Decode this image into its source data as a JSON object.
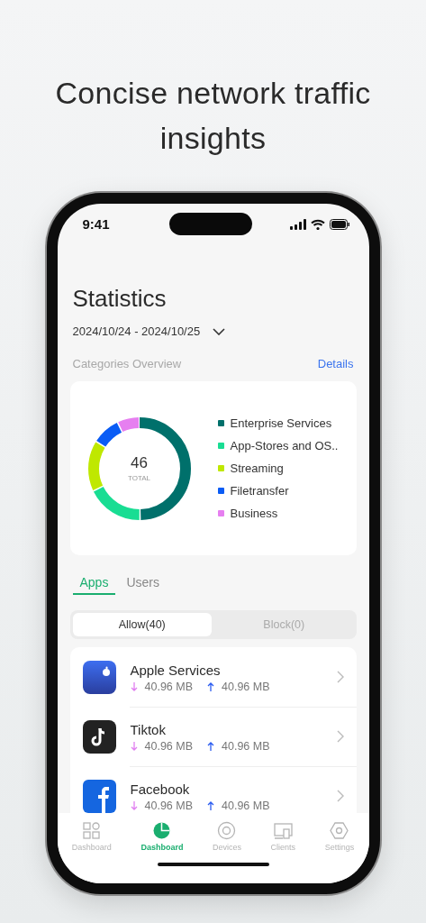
{
  "headline": "Concise network traffic insights",
  "status_bar": {
    "time": "9:41"
  },
  "title": "Statistics",
  "date_range": "2024/10/24 - 2024/10/25",
  "section": {
    "title": "Categories Overview",
    "link": "Details"
  },
  "categories_card": {
    "total": "46",
    "total_label": "TOTAL",
    "legend": [
      {
        "label": "Enterprise Services",
        "color": "#00706b"
      },
      {
        "label": "App-Stores and OS..",
        "color": "#19dd93"
      },
      {
        "label": "Streaming",
        "color": "#bfe800"
      },
      {
        "label": "Filetransfer",
        "color": "#0a5cf5"
      },
      {
        "label": "Business",
        "color": "#e67ff0"
      }
    ]
  },
  "tabs": [
    {
      "label": "Apps",
      "selected": true
    },
    {
      "label": "Users",
      "selected": false
    }
  ],
  "segments": [
    {
      "label": "Allow(40)",
      "selected": true
    },
    {
      "label": "Block(0)",
      "selected": false
    }
  ],
  "apps": [
    {
      "name": "Apple Services",
      "download": "40.96 MB",
      "upload": "40.96 MB"
    },
    {
      "name": "Tiktok",
      "download": "40.96 MB",
      "upload": "40.96 MB"
    },
    {
      "name": "Facebook",
      "download": "40.96 MB",
      "upload": "40.96 MB"
    }
  ],
  "nav": [
    {
      "label": "Dashboard",
      "selected": false
    },
    {
      "label": "Dashboard",
      "selected": true
    },
    {
      "label": "Devices",
      "selected": false
    },
    {
      "label": "Clients",
      "selected": false
    },
    {
      "label": "Settings",
      "selected": false
    }
  ]
}
